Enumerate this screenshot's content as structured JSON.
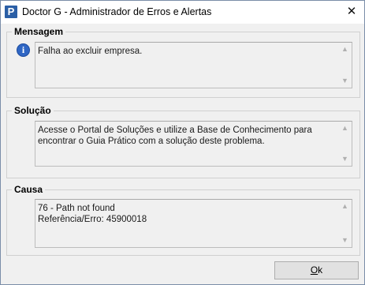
{
  "window": {
    "app_icon_letter": "P",
    "title": "Doctor G - Administrador de Erros e Alertas",
    "close_glyph": "✕"
  },
  "mensagem": {
    "label": "Mensagem",
    "icon": "info-icon",
    "icon_glyph": "i",
    "text": "Falha ao excluir empresa."
  },
  "solucao": {
    "label": "Solução",
    "text": "Acesse o Portal de Soluções e utilize a Base de Conhecimento para encontrar o Guia Prático com a solução deste problema."
  },
  "causa": {
    "label": "Causa",
    "line1": "76 - Path not found",
    "line2": "Referência/Erro: 45900018"
  },
  "buttons": {
    "ok_mnemonic": "O",
    "ok_rest": "k"
  },
  "scroll_glyphs": {
    "up": "▲",
    "down": "▼"
  }
}
